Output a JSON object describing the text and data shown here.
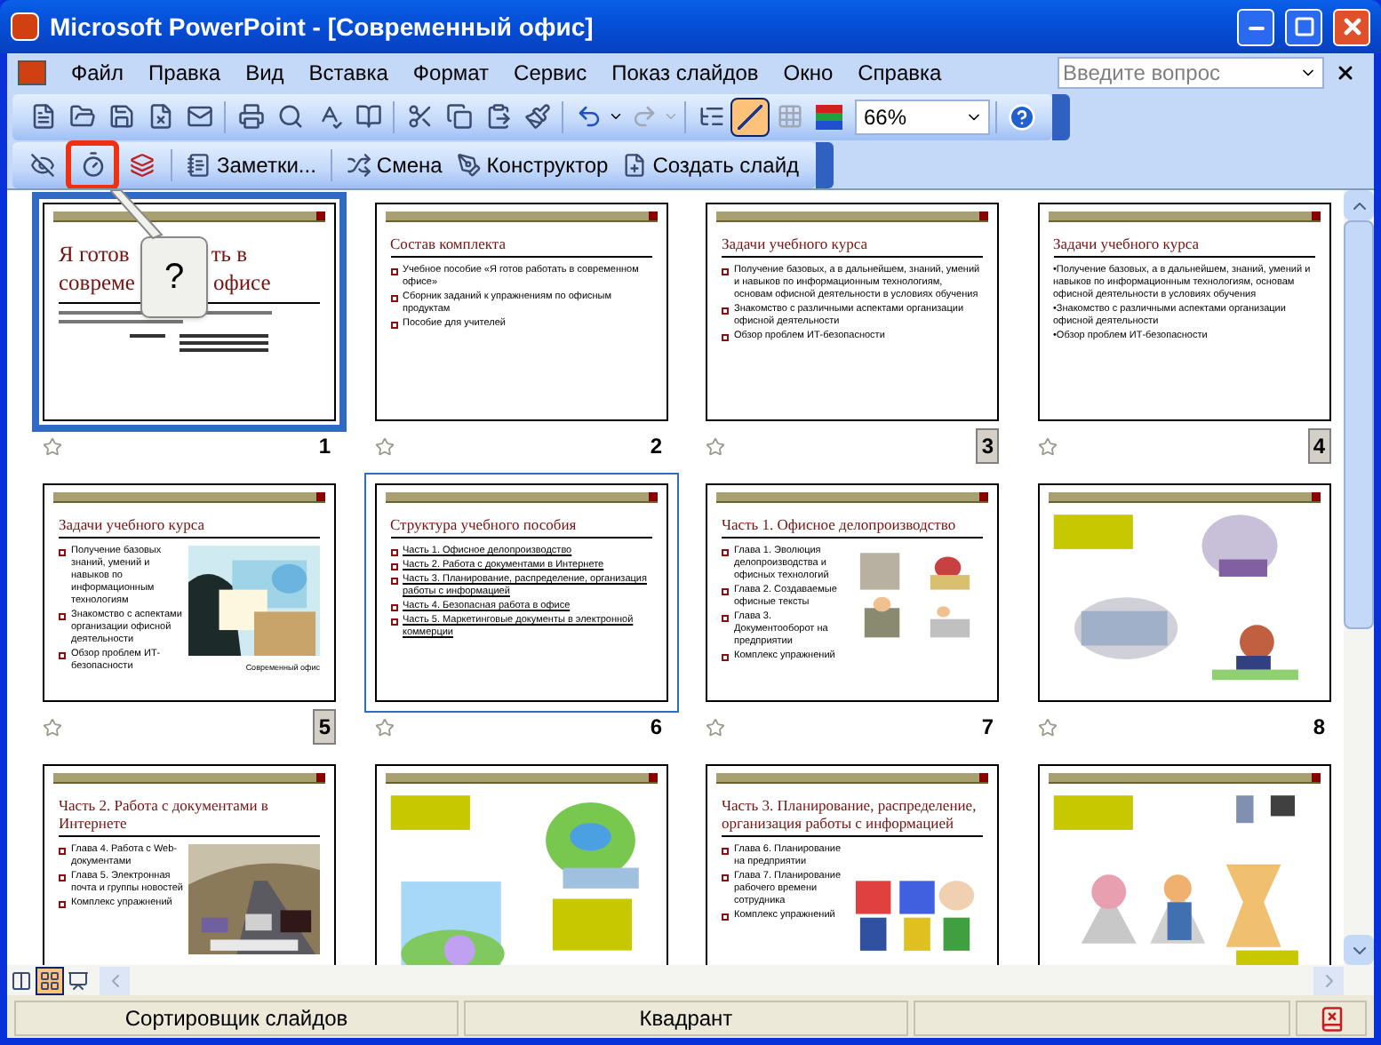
{
  "window": {
    "title": "Microsoft PowerPoint - [Современный офис]"
  },
  "menu": [
    "Файл",
    "Правка",
    "Вид",
    "Вставка",
    "Формат",
    "Сервис",
    "Показ слайдов",
    "Окно",
    "Справка"
  ],
  "help_search": {
    "placeholder": "Введите вопрос"
  },
  "standard_toolbar": {
    "zoom": "66%",
    "show_formatting_selected": true
  },
  "sorter_toolbar": {
    "buttons": [
      {
        "label": "Заметки..."
      },
      {
        "label": "Смена"
      },
      {
        "label": "Конструктор"
      },
      {
        "label": "Создать слайд"
      }
    ],
    "timing_button_highlighted": true
  },
  "tooltip": {
    "text": "?"
  },
  "slides": [
    {
      "kind": "title",
      "number": "1",
      "selected": true,
      "focused": false,
      "hidden": false,
      "title_parts": [
        "Я готов",
        "ть в",
        "совреме",
        "офисе"
      ]
    },
    {
      "kind": "bullets",
      "number": "2",
      "selected": false,
      "focused": false,
      "hidden": false,
      "square_bullets": true,
      "title": "Состав комплекта",
      "bullets": [
        "Учебное пособие «Я готов работать в современном офисе»",
        "Сборник заданий к упражнениям по офисным продуктам",
        "Пособие для учителей"
      ]
    },
    {
      "kind": "bullets",
      "number": "3",
      "selected": false,
      "focused": false,
      "hidden": true,
      "square_bullets": true,
      "title": "Задачи учебного курса",
      "bullets": [
        "Получение базовых, а в дальнейшем, знаний, умений и навыков по информационным технологиям, основам офисной деятельности в условиях обучения",
        "Знакомство с различными аспектами организации офисной деятельности",
        "Обзор проблем ИТ-безопасности"
      ]
    },
    {
      "kind": "bullets",
      "number": "4",
      "selected": false,
      "focused": false,
      "hidden": true,
      "square_bullets": false,
      "title": "Задачи учебного курса",
      "bullets": [
        "•Получение базовых, а в дальнейшем, знаний, умений и навыков по информационным технологиям, основам офисной деятельности в условиях обучения",
        "•Знакомство с различными аспектами организации офисной деятельности",
        "•Обзор проблем ИТ-безопасности"
      ]
    },
    {
      "kind": "bullets_picture",
      "number": "5",
      "selected": false,
      "focused": false,
      "hidden": true,
      "square_bullets": true,
      "title": "Задачи учебного курса",
      "bullets": [
        "Получение базовых знаний, умений и навыков по информационным технологиям",
        "Знакомство с аспектами организации офисной деятельности",
        "Обзор проблем ИТ-безопасности"
      ],
      "caption": "Современный офис"
    },
    {
      "kind": "bullets",
      "number": "6",
      "selected": false,
      "focused": true,
      "hidden": false,
      "square_bullets": true,
      "links": true,
      "title": "Структура учебного пособия",
      "bullets": [
        "Часть 1. Офисное делопроизводство",
        "Часть 2. Работа с документами в Интернете",
        "Часть 3. Планирование, распределение, организация работы с информацией",
        "Часть 4. Безопасная работа в офисе",
        "Часть 5. Маркетинговые документы в электронной коммерции"
      ]
    },
    {
      "kind": "bullets_picture",
      "number": "7",
      "selected": false,
      "focused": false,
      "hidden": false,
      "square_bullets": true,
      "title": "Часть 1. Офисное делопроизводство",
      "bullets": [
        "Глава 1. Эволюция делопроизводства и офисных технологий",
        "Глава 2. Создаваемые офисные тексты",
        "Глава 3. Документооборот на предприятии",
        "Комплекс упражнений"
      ]
    },
    {
      "kind": "pictures",
      "number": "8",
      "selected": false,
      "focused": false,
      "hidden": false
    },
    {
      "kind": "bullets_picture",
      "selected": false,
      "focused": false,
      "square_bullets": true,
      "title": "Часть 2. Работа с документами в Интернете",
      "bullets": [
        "Глава 4. Работа с Web-документами",
        "Глава 5. Электронная почта и группы новостей",
        "Комплекс упражнений"
      ]
    },
    {
      "kind": "pictures",
      "selected": false,
      "focused": false
    },
    {
      "kind": "bullets_picture",
      "selected": false,
      "focused": false,
      "square_bullets": true,
      "title": "Часть 3. Планирование, распределение, организация работы с информацией",
      "bullets": [
        "Глава 6. Планирование на предприятии",
        "Глава 7. Планирование рабочего времени сотрудника",
        "Комплекс упражнений"
      ]
    },
    {
      "kind": "pictures",
      "selected": false,
      "focused": false
    }
  ],
  "view_buttons": [
    {
      "selected": false
    },
    {
      "selected": true
    },
    {
      "selected": false
    }
  ],
  "status_bar": [
    "Сортировщик слайдов",
    "Квадрант"
  ]
}
